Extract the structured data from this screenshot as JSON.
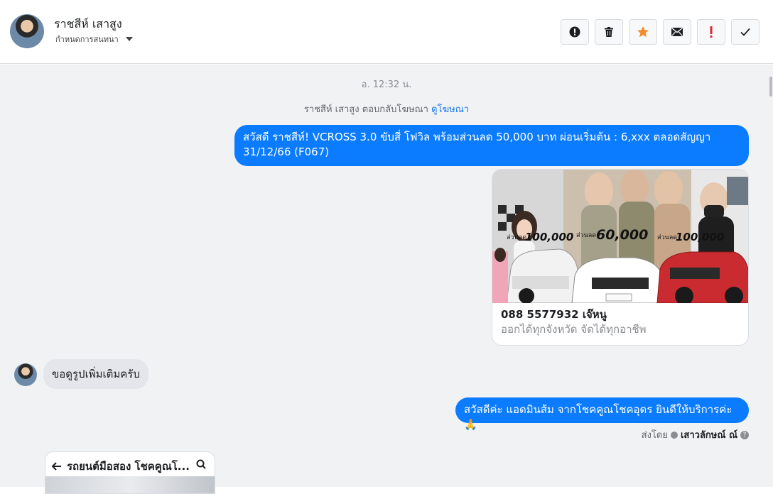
{
  "header": {
    "contact_name": "ราชสีห์ เสาสูง",
    "assign_label": "กำหนดการสนทนา",
    "toolbar": {
      "icons": [
        "alert-icon",
        "trash-icon",
        "star-icon",
        "mail-icon",
        "exclamation-icon",
        "check-icon"
      ],
      "star_color": "#f58a2a",
      "exclamation_color": "#e4252c"
    }
  },
  "chat": {
    "timestamp": "อ. 12:32 น.",
    "reply_note": "ราชสีห์ เสาสูง ตอบกลับโฆษณา",
    "reply_link": "ดูโฆษณา",
    "outgoing_1": "สวัสดี ราชสีห์! VCROSS 3.0 ขับสี่ โฟวิล พร้อมส่วนลด 50,000 บาท ผ่อนเริ่มต้น : 6,xxx ตลอดสัญญา 31/12/66 (F067)",
    "ad": {
      "discount_left": "100,000",
      "discount_mid": "60,000",
      "discount_right": "100,000",
      "discount_prefix": "ส่วนลด",
      "title": "088 5577932 เจ๊หนู",
      "subtitle": "ออกได้ทุกจังหวัด จัดได้ทุกอาชีพ"
    },
    "incoming_1": "ขอดูรูปเพิ่มเติมครับ",
    "outgoing_2": "สวัสดีค่ะ แอดมินส้ม จากโชคคูณโชคอุดร ยินดีให้บริการค่ะ🙏",
    "sent_by_label": "ส่งโดย",
    "sent_by_agent": "เสาวลักษณ์ ณ์",
    "phone_preview_title": "รถยนต์มือสอง โชคคูณโ..."
  },
  "colors": {
    "outgoing_bubble": "#0b7cff",
    "incoming_bubble": "#e4e6eb",
    "link": "#1877f2"
  }
}
